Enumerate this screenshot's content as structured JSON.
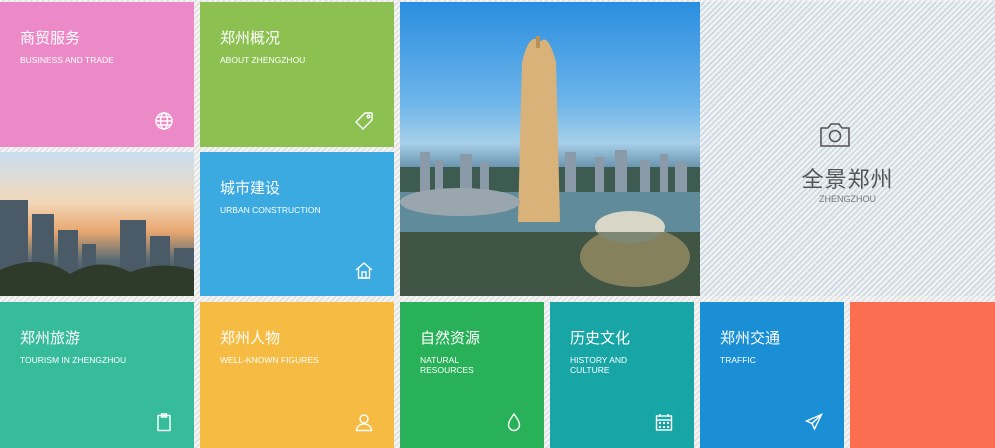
{
  "tiles": {
    "business": {
      "zh": "商贸服务",
      "en": "BUSINESS AND TRADE",
      "color": "#ec8ac8",
      "icon": "globe-icon"
    },
    "about": {
      "zh": "郑州概况",
      "en": "ABOUT ZHENGZHOU",
      "color": "#8cc152",
      "icon": "tag-icon"
    },
    "urban": {
      "zh": "城市建设",
      "en": "URBAN CONSTRUCTION",
      "color": "#3aaae1",
      "icon": "home-icon"
    },
    "tourism": {
      "zh": "郑州旅游",
      "en": "TOURISM IN ZHENGZHOU",
      "color": "#37bc9b",
      "icon": "clipboard-icon"
    },
    "figures": {
      "zh": "郑州人物",
      "en": "WELL-KNOWN FIGURES",
      "color": "#f6bb42",
      "icon": "user-icon"
    },
    "nature": {
      "zh": "自然资源",
      "en": "NATURAL RESOURCES",
      "color": "#29b159",
      "icon": "drop-icon"
    },
    "history": {
      "zh": "历史文化",
      "en": "HISTORY AND CULTURE",
      "color": "#17a5a5",
      "icon": "calendar-icon"
    },
    "traffic": {
      "zh": "郑州交通",
      "en": "TRAFFIC",
      "color": "#1a8fd6",
      "icon": "plane-icon"
    },
    "extra": {
      "color": "#fc6e51"
    }
  },
  "panorama": {
    "zh": "全景郑州",
    "en": "ZHENGZHOU",
    "icon": "camera-icon"
  }
}
